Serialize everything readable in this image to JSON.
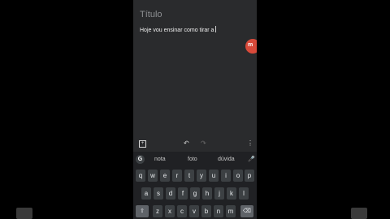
{
  "note": {
    "title_placeholder": "Título",
    "body_text": "Hoje vou ensinar como tirar a"
  },
  "fab": {
    "icon": "m"
  },
  "toolbar": {
    "add_icon": "+",
    "undo_icon": "↶",
    "redo_icon": "↷",
    "more_icon": "⋮"
  },
  "keyboard": {
    "google_logo": "G",
    "suggestions": [
      "nota",
      "foto",
      "dúvida"
    ],
    "mic_icon": "🎤",
    "row1": [
      "q",
      "w",
      "e",
      "r",
      "t",
      "y",
      "u",
      "i",
      "o",
      "p"
    ],
    "row2": [
      "a",
      "s",
      "d",
      "f",
      "g",
      "h",
      "j",
      "k",
      "l"
    ],
    "row3": [
      "⇧",
      "z",
      "x",
      "c",
      "v",
      "b",
      "n",
      "m",
      "⌫"
    ]
  }
}
